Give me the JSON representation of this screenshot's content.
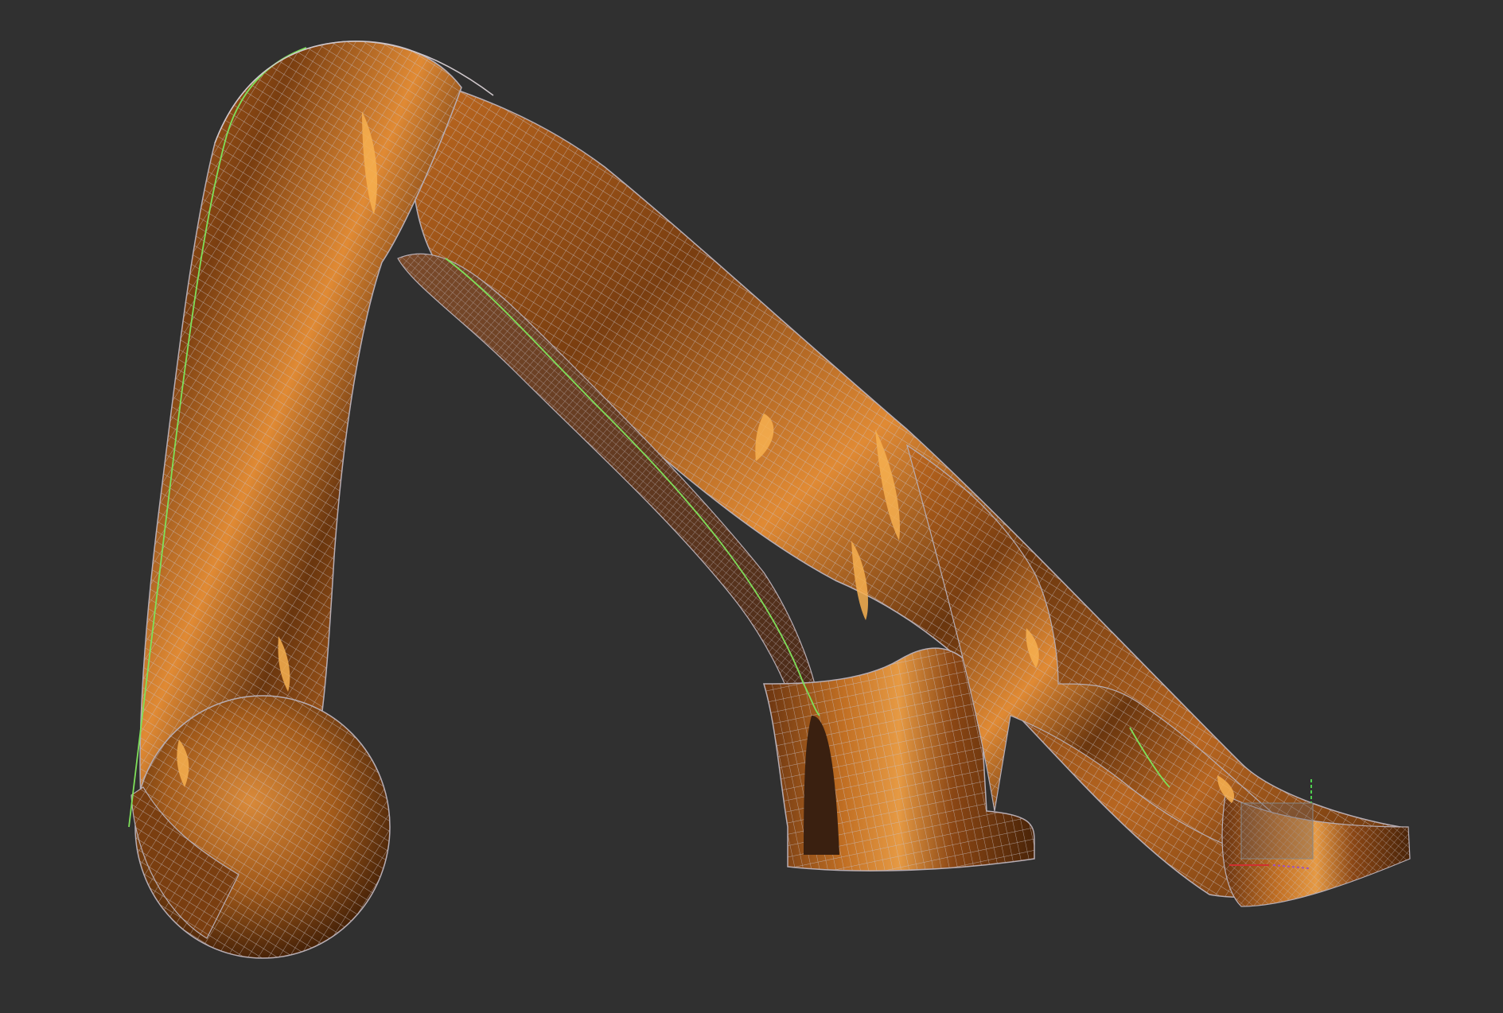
{
  "viewport": {
    "background_color": "#303030",
    "shading": "smooth-with-wireframe",
    "colors": {
      "material_base": "#8a4a14",
      "material_highlight": "#f0a040",
      "material_shadow": "#3a1e08",
      "wire": "#c8c0c4",
      "seam": "#7fe05a",
      "gizmo_x": "#d03030",
      "gizmo_y": "#50d050",
      "gizmo_z": "#a050c0"
    }
  },
  "model": {
    "object_type": "mesh",
    "material_name": "copper"
  },
  "gizmo": {
    "axes": [
      "x",
      "y",
      "z"
    ]
  }
}
